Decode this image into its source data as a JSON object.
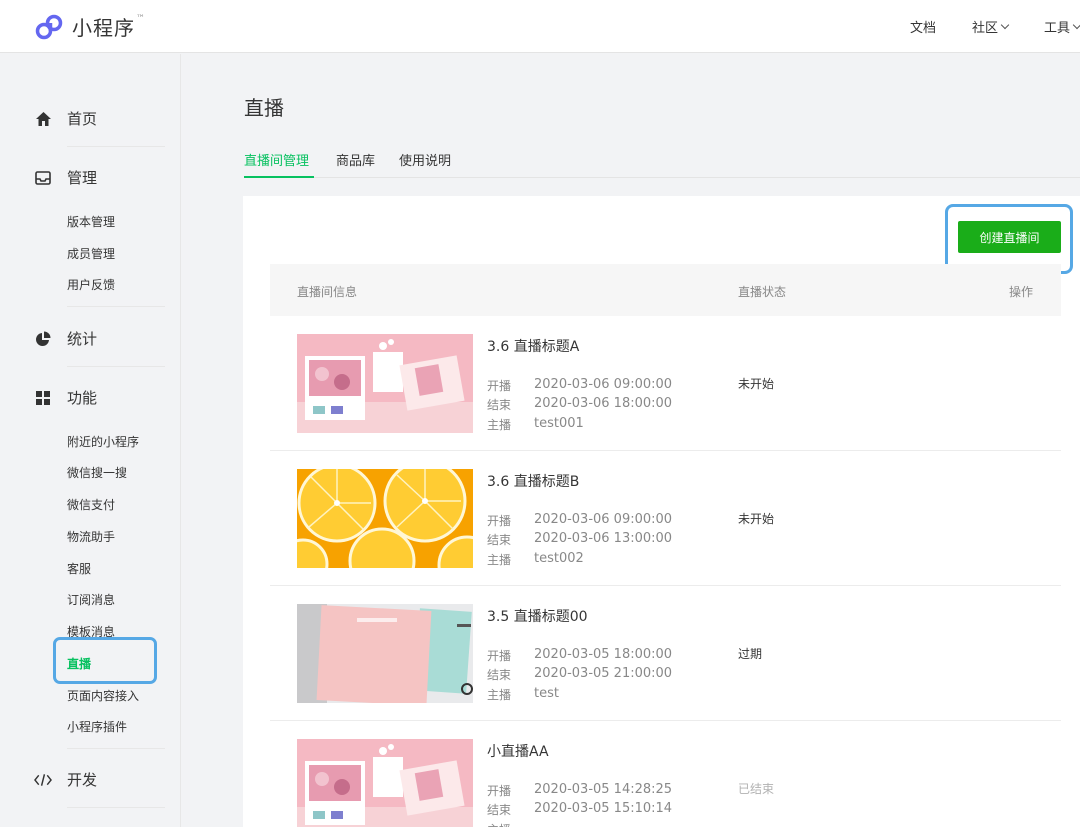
{
  "header": {
    "logo_text": "小程序",
    "logo_tm": "™",
    "nav": {
      "docs": "文档",
      "community": "社区",
      "tools": "工具"
    }
  },
  "sidebar": {
    "home": "首页",
    "manage": "管理",
    "manage_items": [
      "版本管理",
      "成员管理",
      "用户反馈"
    ],
    "stats": "统计",
    "features": "功能",
    "feature_items": [
      "附近的小程序",
      "微信搜一搜",
      "微信支付",
      "物流助手",
      "客服",
      "订阅消息",
      "模板消息",
      "直播",
      "页面内容接入",
      "小程序插件"
    ],
    "dev": "开发",
    "active_item": "直播"
  },
  "main": {
    "title": "直播",
    "tabs": [
      "直播间管理",
      "商品库",
      "使用说明"
    ],
    "create_button": "创建直播间",
    "table_headers": {
      "info": "直播间信息",
      "status": "直播状态",
      "operation": "操作"
    },
    "meta_labels": {
      "start": "开播",
      "end": "结束",
      "anchor": "主播"
    },
    "rows": [
      {
        "title": "3.6 直播标题A",
        "start": "2020-03-06 09:00:00",
        "end": "2020-03-06 18:00:00",
        "anchor": "test001",
        "status": "未开始",
        "thumb": "pink-giftbox"
      },
      {
        "title": "3.6 直播标题B",
        "start": "2020-03-06 09:00:00",
        "end": "2020-03-06 13:00:00",
        "anchor": "test002",
        "status": "未开始",
        "thumb": "orange-slices"
      },
      {
        "title": "3.5 直播标题00",
        "start": "2020-03-05 18:00:00",
        "end": "2020-03-05 21:00:00",
        "anchor": "test",
        "status": "过期",
        "thumb": "notebooks"
      },
      {
        "title": "小直播AA",
        "start": "2020-03-05 14:28:25",
        "end": "2020-03-05 15:10:14",
        "anchor": "",
        "status": "已结束",
        "thumb": "pink-giftbox"
      }
    ]
  },
  "colors": {
    "accent_green": "#07c160",
    "button_green": "#1aad19",
    "highlight_blue": "#56a8e5"
  }
}
